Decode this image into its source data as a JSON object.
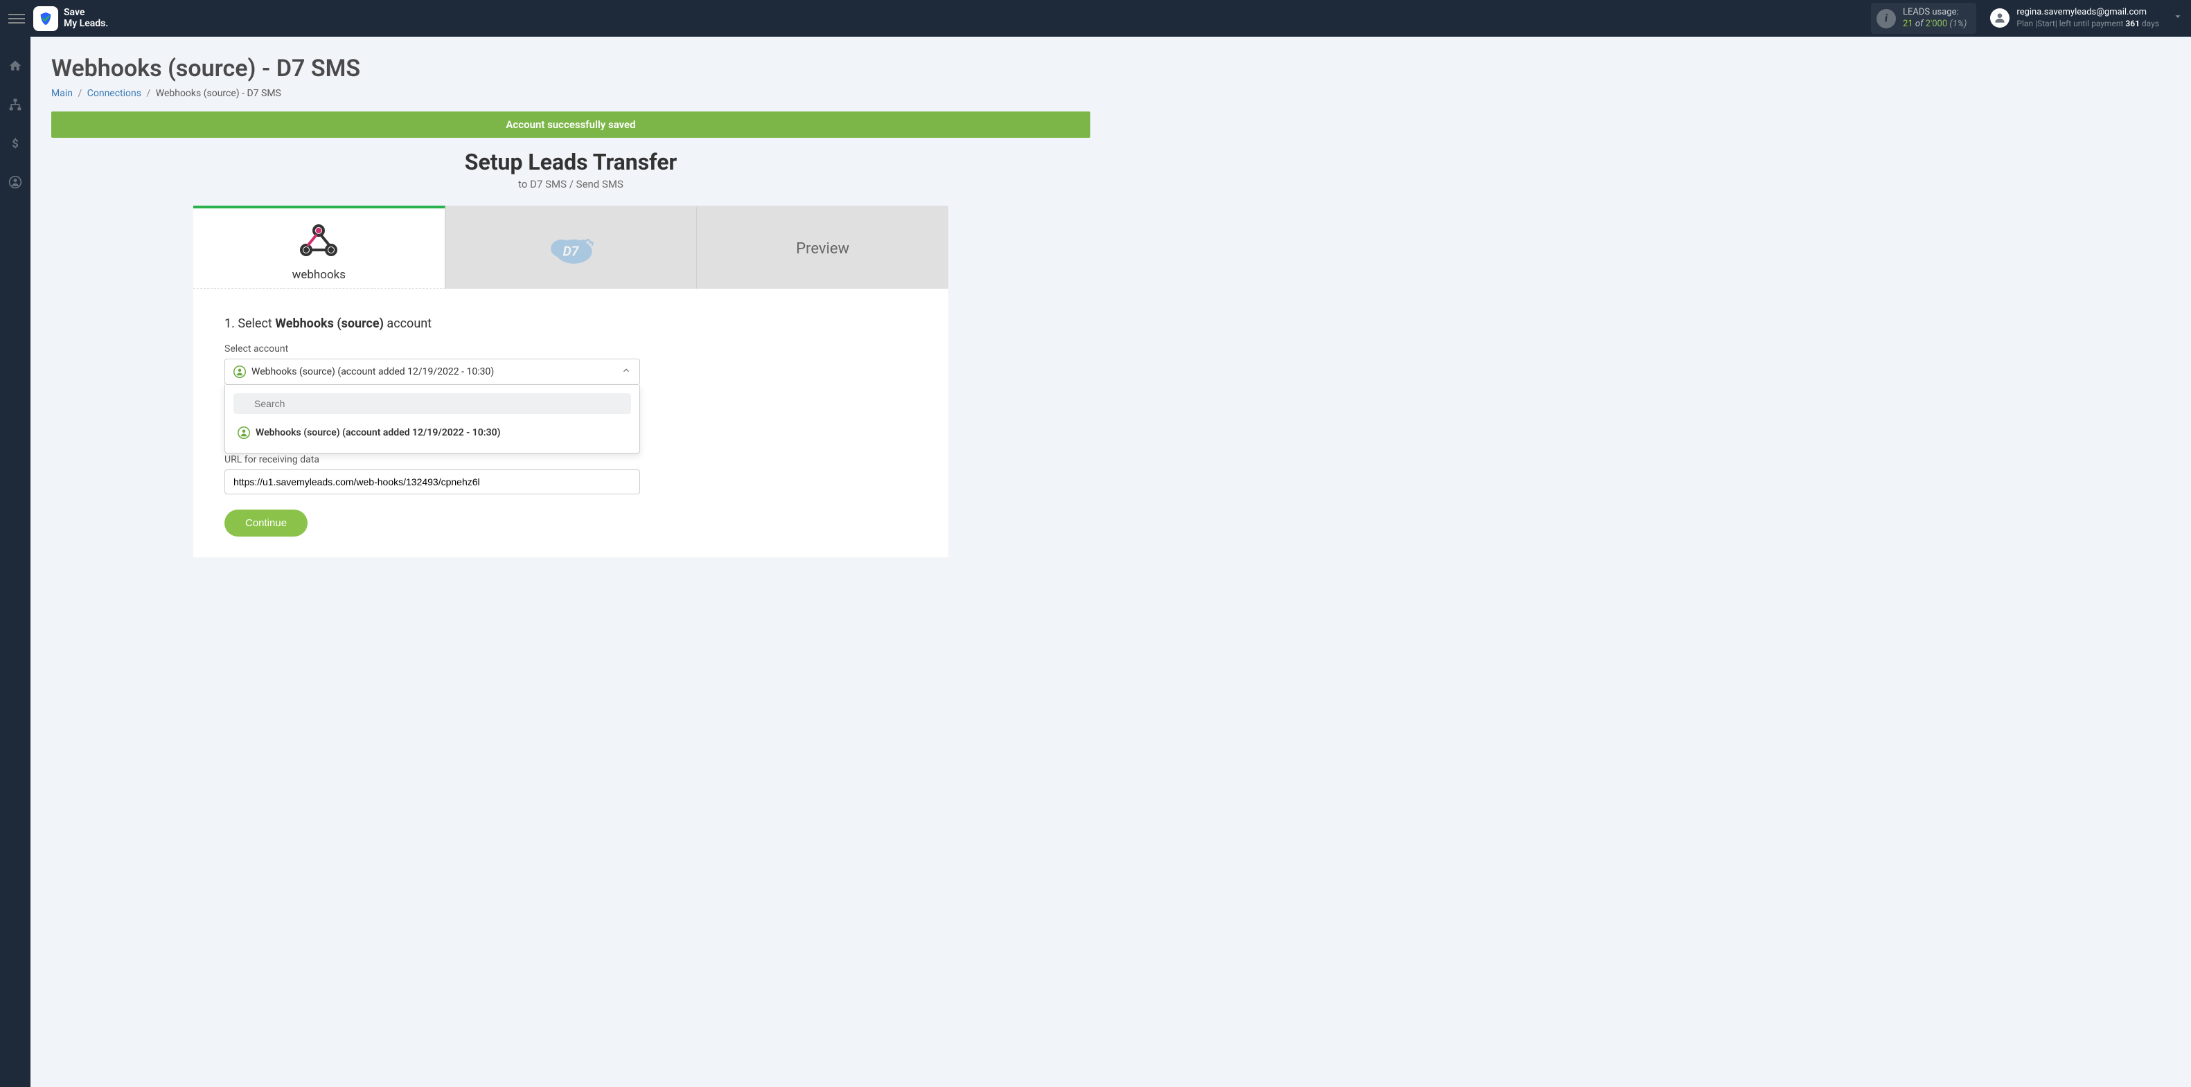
{
  "logo": {
    "line1": "Save",
    "line2": "My Leads."
  },
  "usage": {
    "label": "LEADS usage:",
    "used": "21",
    "of": "of",
    "total": "2'000",
    "pct": "(1%)"
  },
  "user": {
    "email": "regina.savemyleads@gmail.com",
    "plan_prefix": "Plan |Start| left until payment ",
    "days": "361",
    "days_suffix": " days"
  },
  "page_title": "Webhooks (source) - D7 SMS",
  "breadcrumb": {
    "main": "Main",
    "connections": "Connections",
    "current": "Webhooks (source) - D7 SMS"
  },
  "alert": "Account successfully saved",
  "setup": {
    "title": "Setup Leads Transfer",
    "subtitle": "to D7 SMS / Send SMS"
  },
  "tabs": {
    "webhooks_label": "webhooks",
    "preview_label": "Preview"
  },
  "step1": {
    "prefix": "1. Select ",
    "strong": "Webhooks (source)",
    "suffix": " account",
    "select_label": "Select account",
    "selected": "Webhooks (source) (account added 12/19/2022 - 10:30)",
    "search_placeholder": "Search",
    "option1": "Webhooks (source) (account added 12/19/2022 - 10:30)",
    "url_label": "URL for receiving data",
    "url_value": "https://u1.savemyleads.com/web-hooks/132493/cpnehz6l",
    "continue": "Continue"
  }
}
